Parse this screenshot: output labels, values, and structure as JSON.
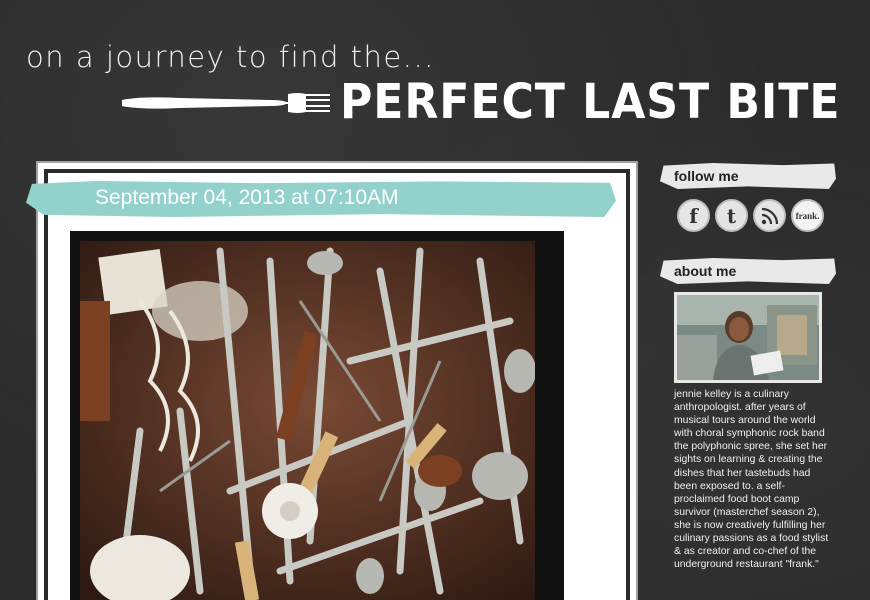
{
  "header": {
    "tagline": "on a journey to find the...",
    "title": "PERFECT LAST BITE"
  },
  "post": {
    "date": "September 04, 2013 at 07:10AM"
  },
  "sidebar": {
    "follow_heading": "follow me",
    "social_icons": [
      {
        "name": "facebook-icon",
        "glyph": "f"
      },
      {
        "name": "twitter-icon",
        "glyph": "t"
      },
      {
        "name": "rss-icon",
        "glyph": ""
      },
      {
        "name": "frank-icon",
        "glyph": "frank."
      }
    ],
    "about_heading": "about me",
    "about_text": "jennie kelley is a culinary anthropologist. after years of musical tours around the world with choral symphonic rock band the polyphonic spree, she set her sights on learning & creating the dishes that her tastebuds had been exposed to. a self-proclaimed food boot camp survivor (masterchef season 2), she is now creatively fulfilling her culinary passions as a food stylist & as creator and co-chef of the underground restaurant \"frank.\""
  },
  "colors": {
    "chalkboard": "#2b2b2b",
    "banner": "#93d1cd"
  }
}
